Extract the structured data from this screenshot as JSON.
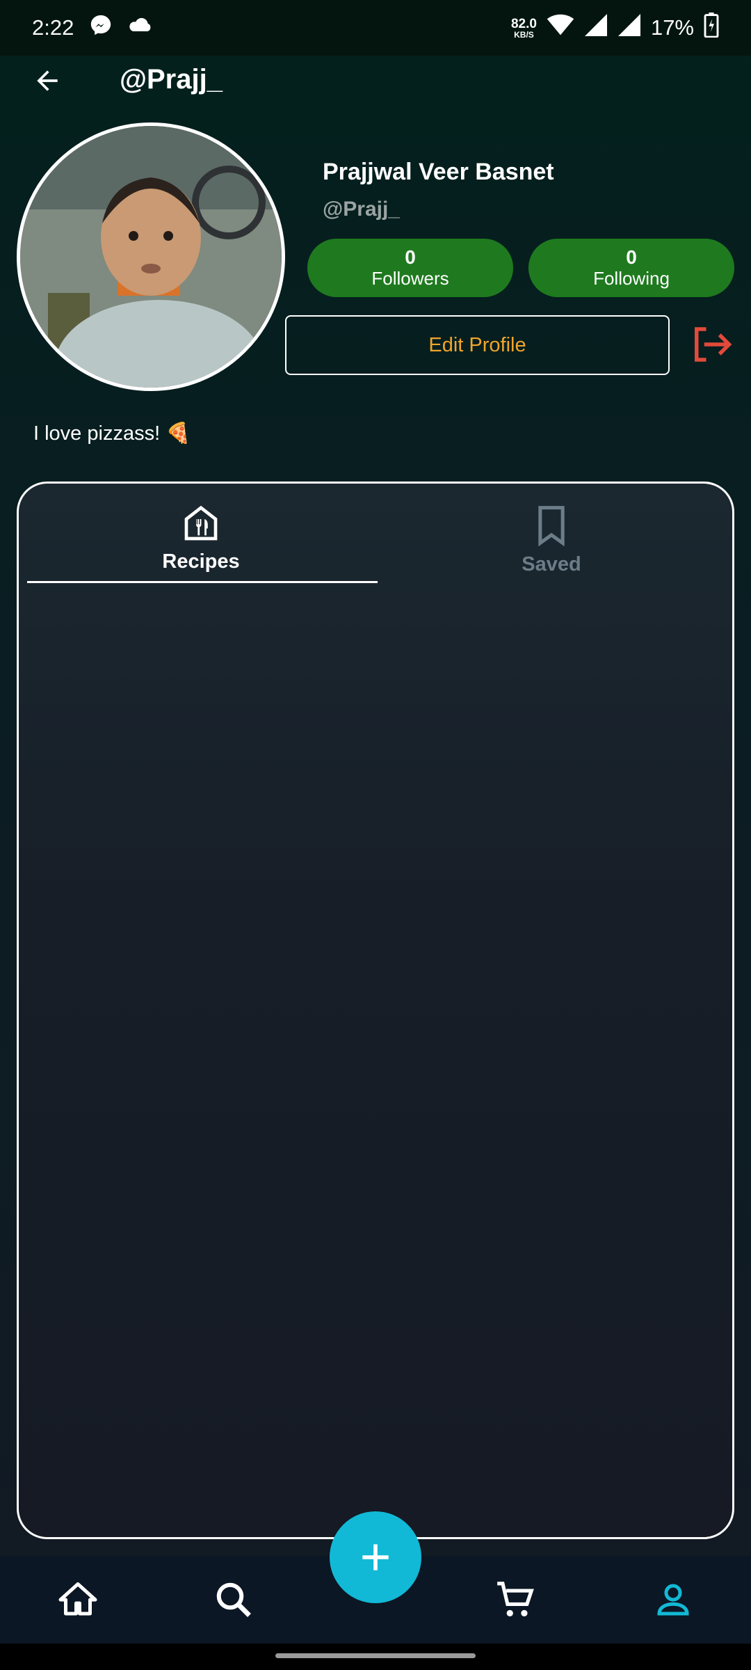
{
  "status_bar": {
    "time": "2:22",
    "net_speed_value": "82.0",
    "net_speed_unit": "KB/S",
    "battery": "17%"
  },
  "header": {
    "title": "@Prajj_"
  },
  "profile": {
    "name": "Prajjwal Veer Basnet",
    "handle": "@Prajj_",
    "followers_count": "0",
    "followers_label": "Followers",
    "following_count": "0",
    "following_label": "Following",
    "edit_label": "Edit Profile",
    "bio": "I love pizzass! 🍕"
  },
  "tabs": [
    {
      "label": "Recipes",
      "active": true
    },
    {
      "label": "Saved",
      "active": false
    }
  ],
  "bottom_nav": {
    "items": [
      "home-icon",
      "search-icon",
      "cart-icon",
      "profile-icon"
    ],
    "active": "profile-icon"
  },
  "colors": {
    "stat_green": "#1f7a1f",
    "edit_orange": "#f0a52a",
    "logout_red": "#e24a3b",
    "accent_cyan": "#12b9d6"
  }
}
